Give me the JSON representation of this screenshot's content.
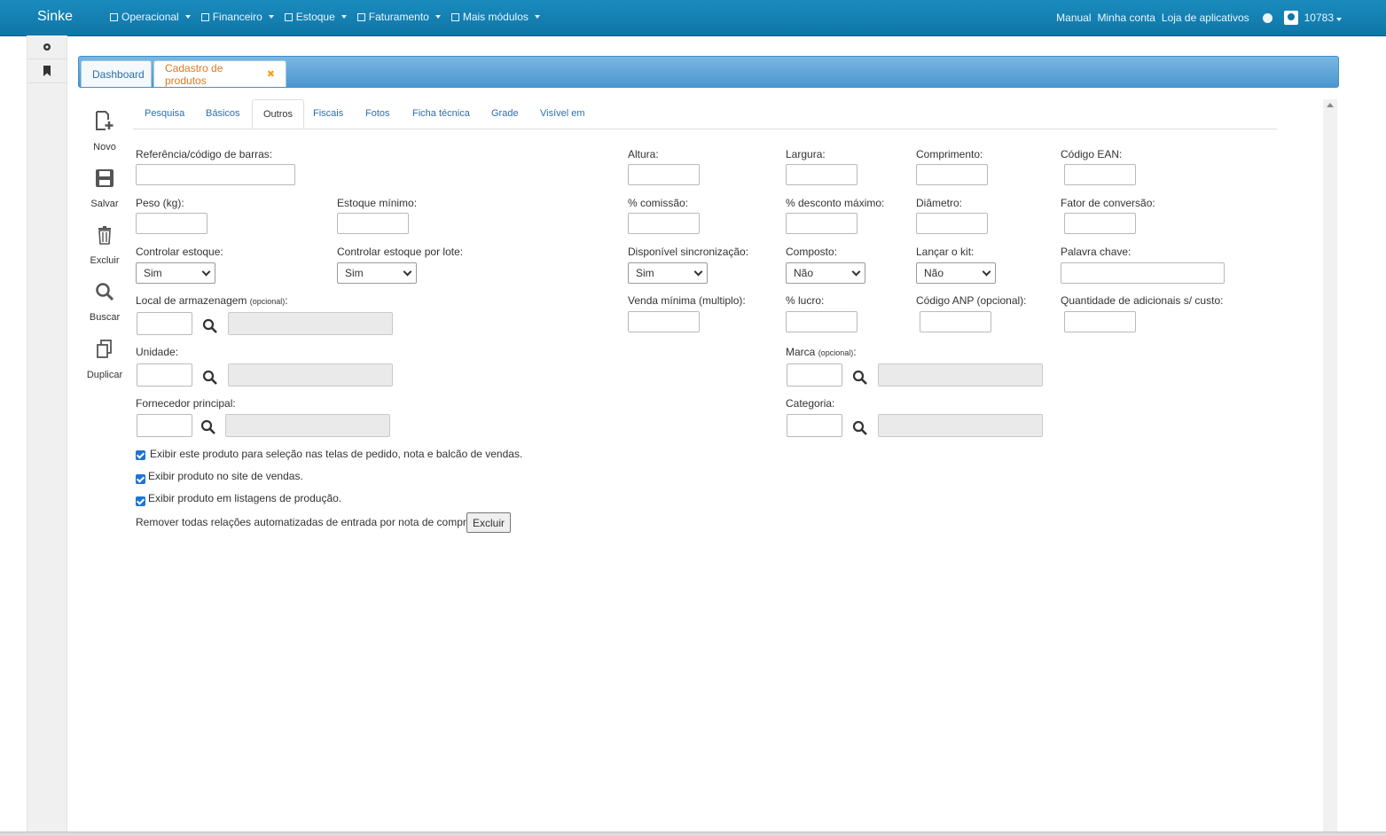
{
  "topbar": {
    "brand": "Sinke",
    "menus": [
      "Operacional",
      "Financeiro",
      "Estoque",
      "Faturamento",
      "Mais módulos"
    ],
    "links": [
      "Manual",
      "Minha conta",
      "Loja de aplicativos"
    ],
    "user": "10783"
  },
  "tabs": {
    "dashboard": "Dashboard",
    "active": "Cadastro de produtos",
    "close": "✖"
  },
  "toolbar": {
    "novo": "Novo",
    "salvar": "Salvar",
    "excluir": "Excluir",
    "buscar": "Buscar",
    "duplicar": "Duplicar"
  },
  "subtabs": [
    "Pesquisa",
    "Básicos",
    "Outros",
    "Fiscais",
    "Fotos",
    "Ficha técnica",
    "Grade",
    "Visível em"
  ],
  "form": {
    "referencia": "Referência/código de barras:",
    "altura": "Altura:",
    "largura": "Largura:",
    "comprimento": "Comprimento:",
    "codigo_ean": "Código EAN:",
    "peso": "Peso (kg):",
    "estoque_minimo": "Estoque mínimo:",
    "comissao": "% comissão:",
    "desconto_maximo": "% desconto máximo:",
    "diametro": "Diâmetro:",
    "fator_conversao": "Fator de conversão:",
    "controlar_estoque": "Controlar estoque:",
    "controlar_estoque_value": "Sim",
    "controlar_lote": "Controlar estoque por lote:",
    "controlar_lote_value": "Sim",
    "disponivel_sinc": "Disponível sincronização:",
    "disponivel_sinc_value": "Sim",
    "composto": "Composto:",
    "composto_value": "Não",
    "lancar_kit": "Lançar o kit:",
    "lancar_kit_value": "Não",
    "palavra_chave": "Palavra chave:",
    "local_armazenagem": "Local de armazenagem",
    "opcional": "(opcional)",
    "colon": ":",
    "venda_minima": "Venda mínima (multiplo):",
    "lucro": "% lucro:",
    "codigo_anp": "Código ANP (opcional):",
    "qtd_adicionais": "Quantidade de adicionais s/ custo:",
    "unidade": "Unidade:",
    "marca": "Marca",
    "fornecedor": "Fornecedor principal:",
    "categoria": "Categoria:",
    "chk1": "Exibir este produto para seleção nas telas de pedido, nota e balcão de vendas.",
    "chk2": "Exibir produto no site de vendas.",
    "chk3": "Exibir produto em listagens de produção.",
    "remover": "Remover todas relações automatizadas de entrada por nota de compra",
    "excluir_btn": "Excluir"
  }
}
